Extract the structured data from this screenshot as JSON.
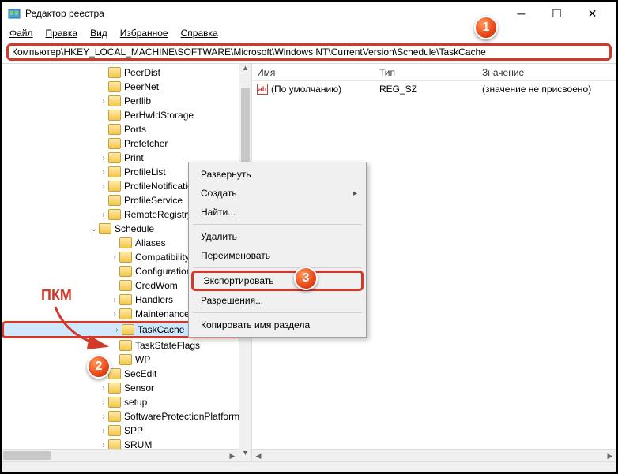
{
  "window": {
    "title": "Редактор реестра"
  },
  "menu": {
    "file": "Файл",
    "edit": "Правка",
    "view": "Вид",
    "favorites": "Избранное",
    "help": "Справка"
  },
  "address": "Компьютер\\HKEY_LOCAL_MACHINE\\SOFTWARE\\Microsoft\\Windows NT\\CurrentVersion\\Schedule\\TaskCache",
  "tree": {
    "items": [
      {
        "indent": 123,
        "label": "PeerDist"
      },
      {
        "indent": 123,
        "label": "PeerNet"
      },
      {
        "indent": 123,
        "label": "Perflib",
        "expander": ">"
      },
      {
        "indent": 123,
        "label": "PerHwIdStorage"
      },
      {
        "indent": 123,
        "label": "Ports"
      },
      {
        "indent": 123,
        "label": "Prefetcher"
      },
      {
        "indent": 123,
        "label": "Print",
        "expander": ">"
      },
      {
        "indent": 123,
        "label": "ProfileList",
        "expander": ">"
      },
      {
        "indent": 123,
        "label": "ProfileNotification",
        "expander": ">"
      },
      {
        "indent": 123,
        "label": "ProfileService"
      },
      {
        "indent": 123,
        "label": "RemoteRegistry",
        "expander": ">"
      },
      {
        "indent": 111,
        "label": "Schedule",
        "expander": "v"
      },
      {
        "indent": 137,
        "label": "Aliases"
      },
      {
        "indent": 137,
        "label": "CompatibilityAdapter",
        "expander": ">"
      },
      {
        "indent": 137,
        "label": "Configuration"
      },
      {
        "indent": 137,
        "label": "CredWom"
      },
      {
        "indent": 137,
        "label": "Handlers",
        "expander": ">"
      },
      {
        "indent": 137,
        "label": "Maintenance",
        "expander": ">"
      },
      {
        "indent": 137,
        "label": "TaskCache",
        "expander": ">",
        "highlight": true,
        "selected": true
      },
      {
        "indent": 137,
        "label": "TaskStateFlags"
      },
      {
        "indent": 137,
        "label": "WP"
      },
      {
        "indent": 123,
        "label": "SecEdit",
        "expander": ">"
      },
      {
        "indent": 123,
        "label": "Sensor",
        "expander": ">"
      },
      {
        "indent": 123,
        "label": "setup",
        "expander": ">"
      },
      {
        "indent": 123,
        "label": "SoftwareProtectionPlatform",
        "expander": ">"
      },
      {
        "indent": 123,
        "label": "SPP",
        "expander": ">"
      },
      {
        "indent": 123,
        "label": "SRUM",
        "expander": ">"
      }
    ]
  },
  "list": {
    "headers": {
      "name": "Имя",
      "type": "Тип",
      "value": "Значение"
    },
    "rows": [
      {
        "name": "(По умолчанию)",
        "type": "REG_SZ",
        "value": "(значение не присвоено)"
      }
    ]
  },
  "contextmenu": {
    "expand": "Развернуть",
    "create": "Создать",
    "find": "Найти...",
    "delete": "Удалить",
    "rename": "Переименовать",
    "export": "Экспортировать",
    "permissions": "Разрешения...",
    "copykey": "Копировать имя раздела"
  },
  "annotation": {
    "pkm": "ПКМ"
  },
  "badges": {
    "b1": "1",
    "b2": "2",
    "b3": "3"
  }
}
